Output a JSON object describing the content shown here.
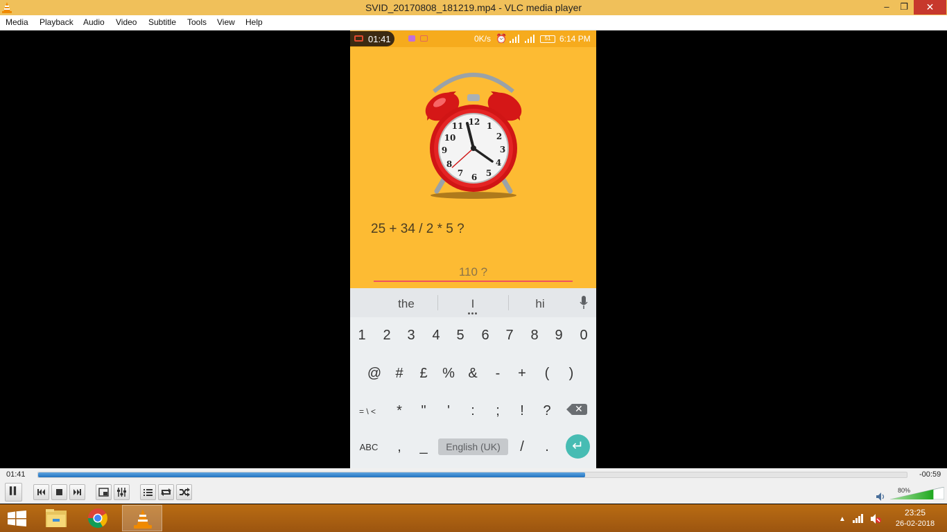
{
  "window": {
    "title": "SVID_20170808_181219.mp4 - VLC media player",
    "min": "–",
    "max": "❐",
    "close": "✕"
  },
  "menu": [
    "Media",
    "Playback",
    "Audio",
    "Video",
    "Subtitle",
    "Tools",
    "View",
    "Help"
  ],
  "phone": {
    "status": {
      "rec_time": "01:41",
      "speed": "0K/s",
      "battery": "51",
      "clock": "6:14 PM"
    },
    "question": "25 + 34 / 2 * 5 ?",
    "answer_hint": "110 ?",
    "keyboard": {
      "suggestions": [
        "the",
        "I",
        "hi"
      ],
      "row1": [
        "1",
        "2",
        "3",
        "4",
        "5",
        "6",
        "7",
        "8",
        "9",
        "0"
      ],
      "row2": [
        "@",
        "#",
        "£",
        "%",
        "&",
        "-",
        "+",
        "(",
        ")"
      ],
      "row3": [
        "= \\ <",
        "*",
        "\"",
        "'",
        ":",
        ";",
        "!",
        "?"
      ],
      "row4_abc": "ABC",
      "row4_comma": ",",
      "row4_underscore": "_",
      "row4_space": "English (UK)",
      "row4_slash": "/",
      "row4_period": ".",
      "enter": "↵"
    }
  },
  "player": {
    "elapsed": "01:41",
    "remaining": "-00:59",
    "progress": 0.63,
    "volume_label": "80%",
    "volume": 0.8
  },
  "taskbar": {
    "time": "23:25",
    "date": "26-02-2018",
    "apps": [
      "file-explorer",
      "chrome",
      "vlc"
    ]
  },
  "colors": {
    "titlebar": "#f0c05a",
    "phone_bg": "#fdbb33",
    "accent_line": "#f0535f",
    "enter_key": "#47bcb3",
    "seek_fill": "#2a7bc8",
    "taskbar": "#b06413"
  }
}
